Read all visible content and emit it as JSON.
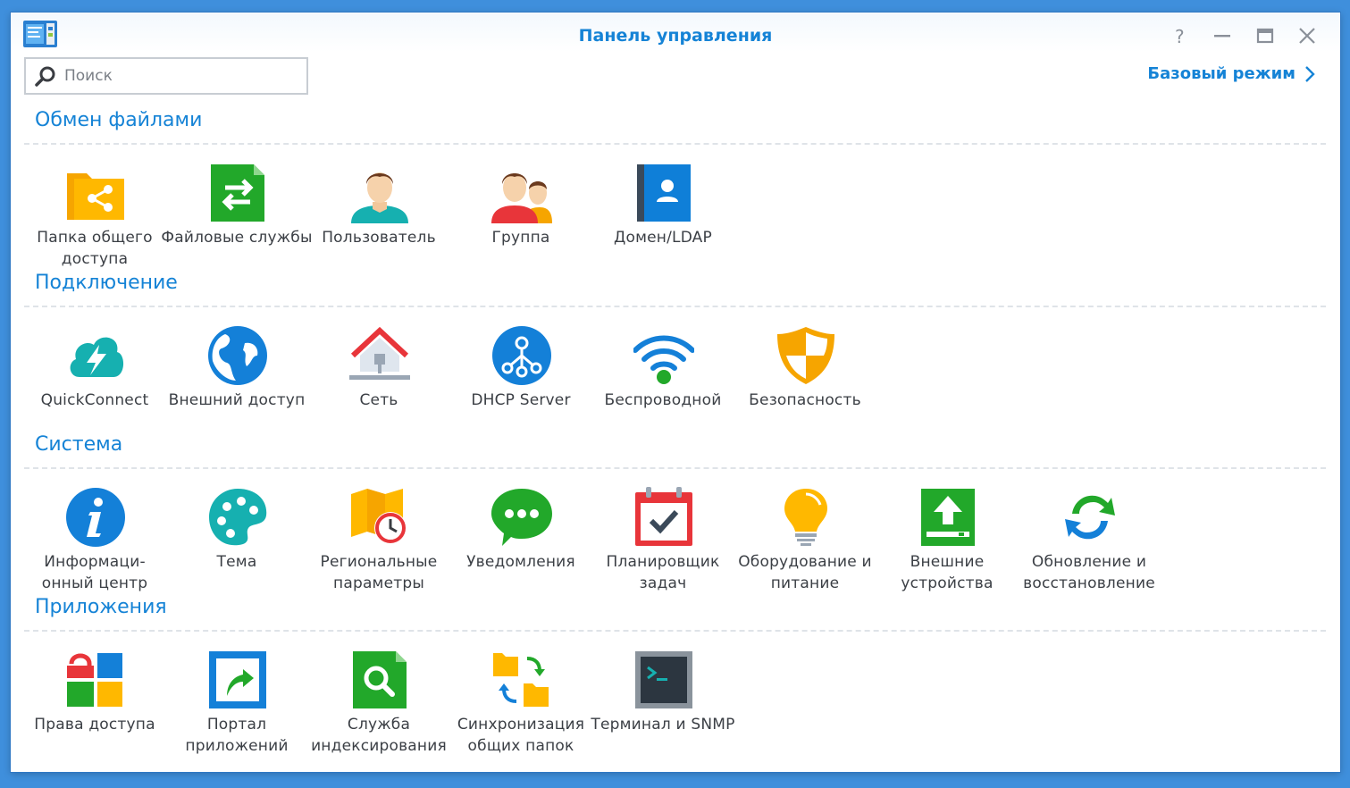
{
  "window": {
    "title": "Панель управления",
    "icons": {
      "app": "control-panel-icon",
      "help": "help-icon",
      "minimize": "minimize-icon",
      "maximize": "maximize-icon",
      "close": "close-icon"
    }
  },
  "search": {
    "value": "",
    "placeholder": "Поиск"
  },
  "mode_link": {
    "label": "Базовый режим"
  },
  "colors": {
    "accent": "#1583d6",
    "desktop": "#3f8fdc"
  },
  "sections": [
    {
      "title": "Обмен файлами",
      "items": [
        {
          "label": "Папка общего доступа",
          "icon": "shared-folder-icon"
        },
        {
          "label": "Файловые службы",
          "icon": "file-services-icon"
        },
        {
          "label": "Пользователь",
          "icon": "user-icon"
        },
        {
          "label": "Группа",
          "icon": "group-icon"
        },
        {
          "label": "Домен/LDAP",
          "icon": "domain-ldap-icon"
        }
      ]
    },
    {
      "title": "Подключение",
      "items": [
        {
          "label": "QuickConnect",
          "icon": "quickconnect-icon"
        },
        {
          "label": "Внешний доступ",
          "icon": "external-access-icon"
        },
        {
          "label": "Сеть",
          "icon": "network-icon"
        },
        {
          "label": "DHCP Server",
          "icon": "dhcp-server-icon"
        },
        {
          "label": "Беспроводной",
          "icon": "wireless-icon"
        },
        {
          "label": "Безопасность",
          "icon": "security-shield-icon"
        }
      ]
    },
    {
      "title": "Система",
      "items": [
        {
          "label": "Информаци-онный центр",
          "icon": "info-center-icon"
        },
        {
          "label": "Тема",
          "icon": "theme-palette-icon"
        },
        {
          "label": "Региональные параметры",
          "icon": "regional-options-icon"
        },
        {
          "label": "Уведомления",
          "icon": "notification-icon"
        },
        {
          "label": "Планировщик задач",
          "icon": "task-scheduler-icon"
        },
        {
          "label": "Оборудование и питание",
          "icon": "hardware-power-icon"
        },
        {
          "label": "Внешние устройства",
          "icon": "external-devices-icon"
        },
        {
          "label": "Обновление и восстановление",
          "icon": "update-restore-icon"
        }
      ]
    },
    {
      "title": "Приложения",
      "items": [
        {
          "label": "Права доступа",
          "icon": "privileges-icon"
        },
        {
          "label": "Портал приложений",
          "icon": "application-portal-icon"
        },
        {
          "label": "Служба индексирования",
          "icon": "indexing-service-icon"
        },
        {
          "label": "Синхронизация общих папок",
          "icon": "shared-folder-sync-icon"
        },
        {
          "label": "Терминал и SNMP",
          "icon": "terminal-snmp-icon"
        }
      ]
    }
  ]
}
